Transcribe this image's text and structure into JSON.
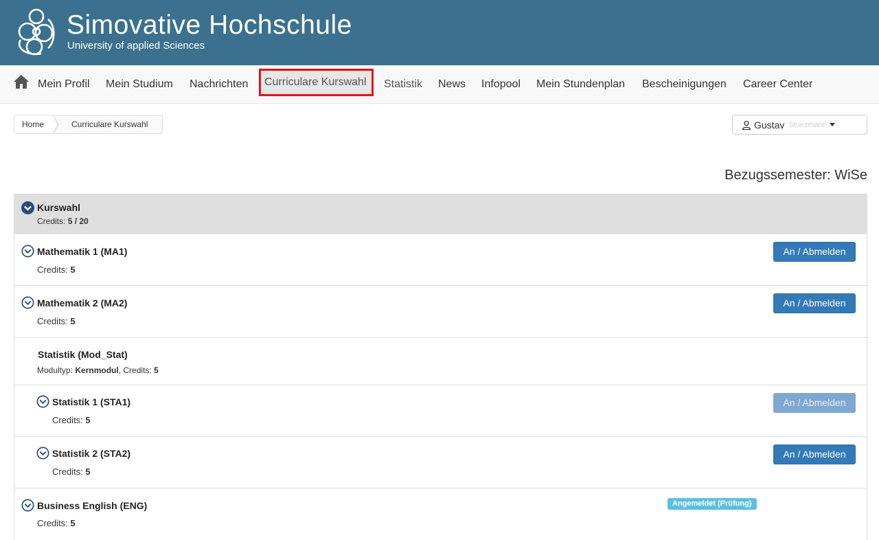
{
  "header": {
    "title": "Simovative Hochschule",
    "subtitle": "University of applied Sciences"
  },
  "nav": {
    "items": [
      {
        "label": "Mein Profil"
      },
      {
        "label": "Mein Studium"
      },
      {
        "label": "Nachrichten"
      },
      {
        "label": "Curriculare Kurswahl",
        "active": true
      },
      {
        "label": "Statistik"
      },
      {
        "label": "News"
      },
      {
        "label": "Infopool"
      },
      {
        "label": "Mein Stundenplan"
      },
      {
        "label": "Bescheinigungen"
      },
      {
        "label": "Career Center"
      }
    ],
    "home_icon": "home-icon"
  },
  "breadcrumb": {
    "home": "Home",
    "current": "Curriculare Kurswahl"
  },
  "user": {
    "first_name": "Gustav",
    "last_name": "Stuezmann"
  },
  "semester": {
    "label": "Bezugssemester: WiSe"
  },
  "panel": {
    "title": "Kurswahl",
    "credits_label": "Credits:",
    "credits_value": "5 / 20",
    "rows": [
      {
        "title": "Mathematik 1 (MA1)",
        "credits_label": "Credits:",
        "credits": "5",
        "button": "An / Abmelden"
      },
      {
        "title": "Mathematik 2 (MA2)",
        "credits_label": "Credits:",
        "credits": "5",
        "button": "An / Abmelden"
      },
      {
        "title": "Statistik (Mod_Stat)",
        "type_label": "Modultyp:",
        "type_value": "Kernmodul",
        "credits_label": "Credits:",
        "credits": "5"
      },
      {
        "title": "Statistik 1 (STA1)",
        "credits_label": "Credits:",
        "credits": "5",
        "button": "An / Abmelden",
        "disabled": true
      },
      {
        "title": "Statistik 2 (STA2)",
        "credits_label": "Credits:",
        "credits": "5",
        "button": "An / Abmelden"
      },
      {
        "title": "Business English (ENG)",
        "credits_label": "Credits:",
        "credits": "5",
        "badge": "Angemeldet (Prüfung)"
      }
    ]
  },
  "colors": {
    "banner": "#3b718f",
    "primary_button": "#337ab7",
    "badge": "#5bc0de",
    "highlight": "#e0131b"
  }
}
